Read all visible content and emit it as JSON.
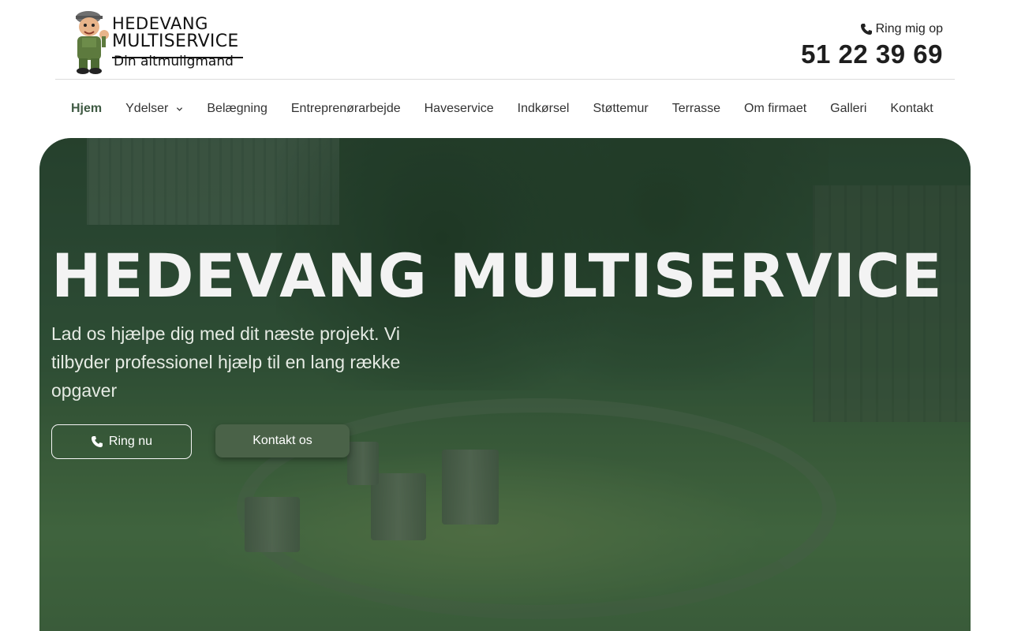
{
  "brand": {
    "line1": "HEDEVANG",
    "line2": "MULTISERVICE",
    "tagline": "Din altmuligmand"
  },
  "contact": {
    "call_label": "Ring mig op",
    "phone": "51 22 39 69"
  },
  "nav": {
    "items": [
      {
        "label": "Hjem",
        "active": true
      },
      {
        "label": "Ydelser",
        "dropdown": true
      },
      {
        "label": "Belægning"
      },
      {
        "label": "Entreprenørarbejde"
      },
      {
        "label": "Haveservice"
      },
      {
        "label": "Indkørsel"
      },
      {
        "label": "Støttemur"
      },
      {
        "label": "Terrasse"
      },
      {
        "label": "Om firmaet"
      },
      {
        "label": "Galleri"
      },
      {
        "label": "Kontakt"
      }
    ]
  },
  "hero": {
    "title": "HEDEVANG MULTISERVICE",
    "subtitle": "Lad os hjælpe dig med dit næste projekt. Vi tilbyder professionel hjælp til en lang række opgaver",
    "btn_call": "Ring nu",
    "btn_contact": "Kontakt os"
  },
  "colors": {
    "accent": "#3f5a43",
    "button_green": "#4a6248"
  },
  "icons": {
    "phone": "phone-icon",
    "dropdown": "chevron-down-icon"
  }
}
